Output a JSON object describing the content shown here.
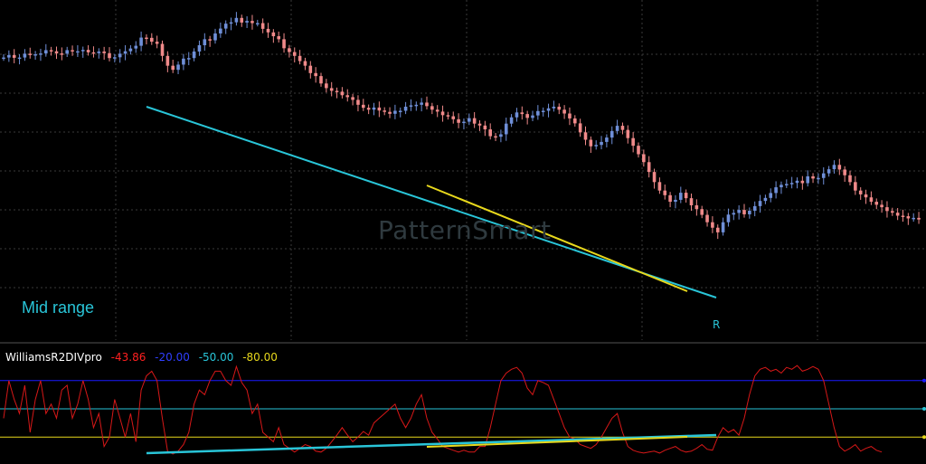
{
  "watermark": "PatternSmart",
  "annotation": "Mid range",
  "divergence_marker": "R",
  "indicator": {
    "name": "WilliamsR2DIVpro",
    "current_value": "-43.86",
    "levels": [
      "-20.00",
      "-50.00",
      "-80.00"
    ]
  },
  "colors": {
    "background": "#000000",
    "bull_candle": "#6f8fd8",
    "bear_candle": "#f08a8a",
    "price_divergence_line": "#29c5d8",
    "secondary_divergence_line": "#e8d81c",
    "indicator_line": "#d81818",
    "level_minus20": "#1a1aff",
    "level_minus50": "#29c5d8",
    "level_minus80": "#e8d81c",
    "grid": "#3a3a3a"
  },
  "chart_data": [
    {
      "type": "candlestick",
      "title": "",
      "xlabel": "",
      "ylabel": "",
      "grid": true,
      "ylim": [
        0,
        100
      ],
      "close_series": [
        84.9,
        85.8,
        84.8,
        84.9,
        86.3,
        86.1,
        86.1,
        86.4,
        87.6,
        87.2,
        86.4,
        86.3,
        87.6,
        87.1,
        87.2,
        87.7,
        86.8,
        86.5,
        87.1,
        86.5,
        84.7,
        85.0,
        86.3,
        87.2,
        88.2,
        89.2,
        92.2,
        92.1,
        90.7,
        89.9,
        85.5,
        81.9,
        80.4,
        82.3,
        84.5,
        84.7,
        87.1,
        89.4,
        91.6,
        91.2,
        93.7,
        95.5,
        97.3,
        97.8,
        99.4,
        97.7,
        98.3,
        97.5,
        97.5,
        95.4,
        94.1,
        92.7,
        91.6,
        88.3,
        86.9,
        85.5,
        83.6,
        81.9,
        79.2,
        78.1,
        75.4,
        73.7,
        72.7,
        72.4,
        71.1,
        70.4,
        69.4,
        67.6,
        66.5,
        65.8,
        66.6,
        65.5,
        65.0,
        64.3,
        65.4,
        65.4,
        66.9,
        67.4,
        67.6,
        68.4,
        67.1,
        65.8,
        65.1,
        63.8,
        63.4,
        62.3,
        61.0,
        61.4,
        62.7,
        60.7,
        60.0,
        58.6,
        56.1,
        55.9,
        56.8,
        60.7,
        63.0,
        64.8,
        64.2,
        62.8,
        63.7,
        65.3,
        65.4,
        66.3,
        66.9,
        65.8,
        64.4,
        62.6,
        60.8,
        57.5,
        54.8,
        52.4,
        52.9,
        54.0,
        55.6,
        58.0,
        59.9,
        58.4,
        55.4,
        52.6,
        49.5,
        46.6,
        43.0,
        39.3,
        36.2,
        34.5,
        32.1,
        32.8,
        35.4,
        33.4,
        30.8,
        29.4,
        27.3,
        24.6,
        22.6,
        20.9,
        24.6,
        27.4,
        28.0,
        29.1,
        27.5,
        28.8,
        30.5,
        32.4,
        33.5,
        35.3,
        37.4,
        38.3,
        38.6,
        39.0,
        39.8,
        38.9,
        41.4,
        40.6,
        40.8,
        42.5,
        44.0,
        45.6,
        43.9,
        41.8,
        39.3,
        36.2,
        34.8,
        33.7,
        32.1,
        31.0,
        30.1,
        28.7,
        28.1,
        27.0,
        26.8,
        26.0,
        26.2,
        25.6
      ]
    },
    {
      "type": "line",
      "title": "WilliamsR2DIVpro",
      "xlabel": "",
      "ylabel": "",
      "ylim": [
        -100,
        0
      ],
      "levels": [
        -20,
        -50,
        -80
      ],
      "series": [
        {
          "name": "WilliamsR2DIVpro",
          "values": [
            -60,
            -20,
            -40,
            -55,
            -25,
            -75,
            -40,
            -20,
            -55,
            -45,
            -60,
            -30,
            -25,
            -60,
            -45,
            -20,
            -40,
            -70,
            -55,
            -90,
            -80,
            -40,
            -60,
            -80,
            -55,
            -85,
            -30,
            -15,
            -10,
            -20,
            -60,
            -95,
            -98,
            -95,
            -88,
            -75,
            -45,
            -30,
            -35,
            -20,
            -10,
            -10,
            -20,
            -25,
            -5,
            -22,
            -30,
            -55,
            -45,
            -75,
            -80,
            -85,
            -70,
            -88,
            -92,
            -96,
            -92,
            -88,
            -90,
            -95,
            -96,
            -92,
            -85,
            -78,
            -70,
            -78,
            -85,
            -80,
            -74,
            -78,
            -65,
            -60,
            -55,
            -50,
            -45,
            -60,
            -70,
            -60,
            -45,
            -35,
            -60,
            -75,
            -82,
            -90,
            -92,
            -94,
            -96,
            -94,
            -96,
            -96,
            -90,
            -90,
            -70,
            -45,
            -20,
            -12,
            -8,
            -6,
            -12,
            -28,
            -35,
            -20,
            -22,
            -25,
            -40,
            -55,
            -70,
            -80,
            -82,
            -88,
            -90,
            -92,
            -88,
            -80,
            -70,
            -60,
            -55,
            -75,
            -90,
            -94,
            -96,
            -97,
            -96,
            -95,
            -97,
            -94,
            -92,
            -90,
            -94,
            -96,
            -95,
            -92,
            -88,
            -93,
            -94,
            -80,
            -70,
            -75,
            -72,
            -78,
            -60,
            -35,
            -15,
            -8,
            -6,
            -10,
            -8,
            -12,
            -6,
            -8,
            -4,
            -10,
            -8,
            -5,
            -8,
            -20,
            -45,
            -70,
            -90,
            -95,
            -92,
            -88,
            -95,
            -92,
            -90,
            -94,
            -96
          ]
        }
      ]
    }
  ]
}
